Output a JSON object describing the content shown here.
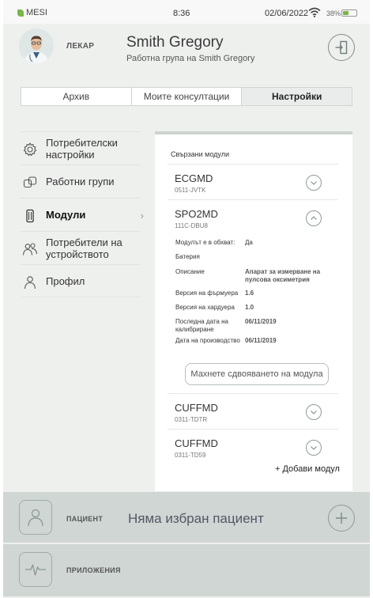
{
  "status_bar": {
    "brand": "MESI",
    "time": "8:36",
    "date": "02/06/2022",
    "battery": "38%"
  },
  "header": {
    "role": "ЛЕКАР",
    "user_name": "Smith Gregory",
    "group": "Работна група на Smith Gregory"
  },
  "tabs": [
    {
      "label": "Архив",
      "active": false
    },
    {
      "label": "Моите консултации",
      "active": false
    },
    {
      "label": "Настройки",
      "active": true
    }
  ],
  "menu": [
    {
      "label": "Потребителски настройки",
      "icon": "gear-icon",
      "active": false
    },
    {
      "label": "Работни групи",
      "icon": "groups-icon",
      "active": false
    },
    {
      "label": "Модули",
      "icon": "module-icon",
      "active": true
    },
    {
      "label": "Потребители на устройството",
      "icon": "users-icon",
      "active": false
    },
    {
      "label": "Профил",
      "icon": "profile-icon",
      "active": false
    }
  ],
  "panel": {
    "title": "Свързани модули",
    "modules": [
      {
        "name": "ECGMD",
        "id": "0511-JVTK",
        "expanded": false
      },
      {
        "name": "SPO2MD",
        "id": "111C-DBU8",
        "expanded": true
      },
      {
        "name": "CUFFMD",
        "id": "0311-TDTR",
        "expanded": false
      },
      {
        "name": "CUFFMD",
        "id": "0311-TD59",
        "expanded": false
      }
    ],
    "details": [
      {
        "key": "Модулът е в обхват:",
        "value": "Да",
        "bold": false
      },
      {
        "key": "Батерия",
        "value": "",
        "bold": false
      },
      {
        "key": "Описание",
        "value": "Апарат за измерване на пулсова оксиметрия",
        "bold": true
      },
      {
        "key": "Версия на фърмуера",
        "value": "1.6",
        "bold": true
      },
      {
        "key": "Версия на хардуера",
        "value": "1.0",
        "bold": true
      },
      {
        "key": "Последна дата на калибриране",
        "value": "06/11/2019",
        "bold": true
      },
      {
        "key": "Дата на производство",
        "value": "06/11/2019",
        "bold": true
      }
    ],
    "unpair_label": "Махнете сдвояването на модула",
    "add_module_label": "+ Добави модул"
  },
  "patient_bar": {
    "label": "ПАЦИЕНТ",
    "status": "Няма избран пациент"
  },
  "apps_bar": {
    "label": "ПРИЛОЖЕНИЯ"
  },
  "colors": {
    "brand_green": "#7ab648",
    "bar_background": "#cfd6d3",
    "frame_background": "#eef0ee"
  }
}
